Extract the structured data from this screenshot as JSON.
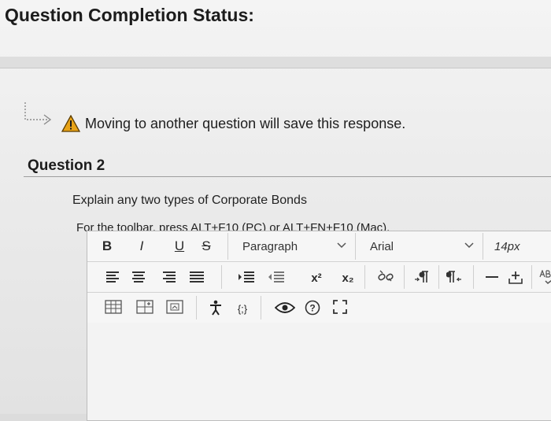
{
  "status": {
    "title": "Question Completion Status:"
  },
  "warning": {
    "text": "Moving to another question will save this response."
  },
  "question": {
    "title": "Question 2",
    "prompt": "Explain any two types of Corporate Bonds"
  },
  "editor": {
    "toolbar_hint": "For the toolbar, press ALT+F10 (PC) or ALT+FN+F10 (Mac).",
    "bold": "B",
    "italic": "I",
    "underline": "U",
    "strikethrough": "S",
    "paragraph_value": "Paragraph",
    "font_value": "Arial",
    "size_value": "14px",
    "superscript": "x²",
    "subscript": "x₂",
    "code_label": "{;}"
  },
  "colors": {
    "warning": "#e8a317",
    "accent": "#222222"
  }
}
